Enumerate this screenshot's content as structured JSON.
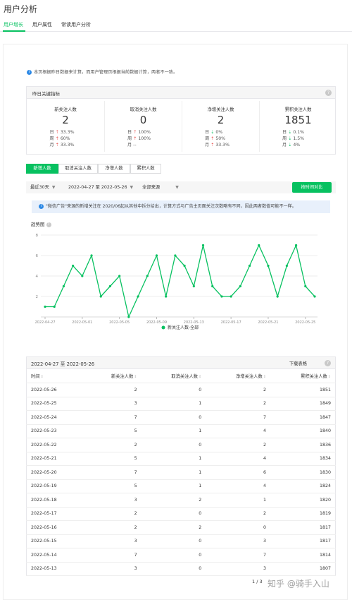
{
  "page_title": "用户分析",
  "nav": {
    "tabs": [
      "用户增长",
      "用户属性",
      "常读用户分析"
    ],
    "active": 0
  },
  "notice": "本页根据昨日数据来计算，而用户管理页根据当前数据计算，两者不一致。",
  "key_metrics": {
    "title": "昨日关键指标",
    "help": "?",
    "metrics": [
      {
        "label": "新关注人数",
        "value": "2",
        "rows": [
          {
            "period": "日",
            "dir": "up",
            "arrow": "⇡",
            "pct": "33.3%"
          },
          {
            "period": "周",
            "dir": "up",
            "arrow": "⇡",
            "pct": "60%"
          },
          {
            "period": "月",
            "dir": "up",
            "arrow": "⇡",
            "pct": "33.3%"
          }
        ]
      },
      {
        "label": "取消关注人数",
        "value": "0",
        "rows": [
          {
            "period": "日",
            "dir": "up",
            "arrow": "⇡",
            "pct": "100%"
          },
          {
            "period": "周",
            "dir": "up",
            "arrow": "⇡",
            "pct": "100%"
          },
          {
            "period": "月",
            "dir": "none",
            "arrow": "",
            "pct": "--"
          }
        ]
      },
      {
        "label": "净增关注人数",
        "value": "2",
        "rows": [
          {
            "period": "日",
            "dir": "down",
            "arrow": "⇣",
            "pct": "0%"
          },
          {
            "period": "周",
            "dir": "up",
            "arrow": "⇡",
            "pct": "50%"
          },
          {
            "period": "月",
            "dir": "up",
            "arrow": "⇡",
            "pct": "33.3%"
          }
        ]
      },
      {
        "label": "累积关注人数",
        "value": "1851",
        "rows": [
          {
            "period": "日",
            "dir": "down",
            "arrow": "⇣",
            "pct": "0.1%"
          },
          {
            "period": "周",
            "dir": "down",
            "arrow": "⇣",
            "pct": "1.5%"
          },
          {
            "period": "月",
            "dir": "down",
            "arrow": "⇣",
            "pct": "4%"
          }
        ]
      }
    ]
  },
  "segments": [
    "新增人数",
    "取消关注人数",
    "净增人数",
    "累积人数"
  ],
  "filters": {
    "range": "最近30天",
    "dates": "2022-04-27 至 2022-05-26",
    "source": "全部来源",
    "compare": "按时间对比"
  },
  "info_bar": "\"微信广告\"来源的新增关注在 2020/06起从其他中拆分给出，计算方式与广告主页面关注次数略有不同，因此两者数值可能不一样。",
  "trend_title": "趋势图",
  "chart_data": {
    "type": "line",
    "x": [
      "2022-04-27",
      "2022-04-28",
      "2022-04-29",
      "2022-04-30",
      "2022-05-01",
      "2022-05-02",
      "2022-05-03",
      "2022-05-04",
      "2022-05-05",
      "2022-05-06",
      "2022-05-07",
      "2022-05-08",
      "2022-05-09",
      "2022-05-10",
      "2022-05-11",
      "2022-05-12",
      "2022-05-13",
      "2022-05-14",
      "2022-05-15",
      "2022-05-16",
      "2022-05-17",
      "2022-05-18",
      "2022-05-19",
      "2022-05-20",
      "2022-05-21",
      "2022-05-22",
      "2022-05-23",
      "2022-05-24",
      "2022-05-25",
      "2022-05-26"
    ],
    "x_tick_labels": [
      "2022-04-27",
      "2022-05-01",
      "2022-05-05",
      "2022-05-09",
      "2022-05-13",
      "2022-05-17",
      "2022-05-21",
      "2022-05-25"
    ],
    "series": [
      {
        "name": "新关注人数-全部",
        "values": [
          1,
          1,
          3,
          5,
          4,
          6,
          2,
          3,
          4,
          0,
          2,
          4,
          6,
          2,
          6,
          5,
          3,
          7,
          3,
          2,
          2,
          3,
          5,
          7,
          5,
          2,
          5,
          7,
          3,
          2
        ]
      }
    ],
    "yticks": [
      2,
      4,
      6,
      8
    ],
    "ylim": [
      0,
      8
    ],
    "grid": true,
    "legend_position": "bottom",
    "color": "#07c160"
  },
  "table": {
    "range_label": "2022-04-27 至 2022-05-26",
    "download": "下载表格",
    "columns": [
      "时间",
      "新关注人数",
      "取消关注人数",
      "净增关注人数",
      "累积关注人数"
    ],
    "rows": [
      [
        "2022-05-26",
        "2",
        "0",
        "2",
        "1851"
      ],
      [
        "2022-05-25",
        "3",
        "1",
        "2",
        "1849"
      ],
      [
        "2022-05-24",
        "7",
        "0",
        "7",
        "1847"
      ],
      [
        "2022-05-23",
        "5",
        "1",
        "4",
        "1840"
      ],
      [
        "2022-05-22",
        "2",
        "0",
        "2",
        "1836"
      ],
      [
        "2022-05-21",
        "5",
        "1",
        "4",
        "1834"
      ],
      [
        "2022-05-20",
        "7",
        "1",
        "6",
        "1830"
      ],
      [
        "2022-05-19",
        "5",
        "1",
        "4",
        "1824"
      ],
      [
        "2022-05-18",
        "3",
        "2",
        "1",
        "1820"
      ],
      [
        "2022-05-17",
        "2",
        "0",
        "2",
        "1819"
      ],
      [
        "2022-05-16",
        "2",
        "2",
        "0",
        "1817"
      ],
      [
        "2022-05-15",
        "3",
        "0",
        "3",
        "1817"
      ],
      [
        "2022-05-14",
        "7",
        "0",
        "7",
        "1814"
      ],
      [
        "2022-05-13",
        "3",
        "0",
        "3",
        "1807"
      ]
    ]
  },
  "pager": "1 / 3",
  "watermark": "知乎 @骑手入山"
}
